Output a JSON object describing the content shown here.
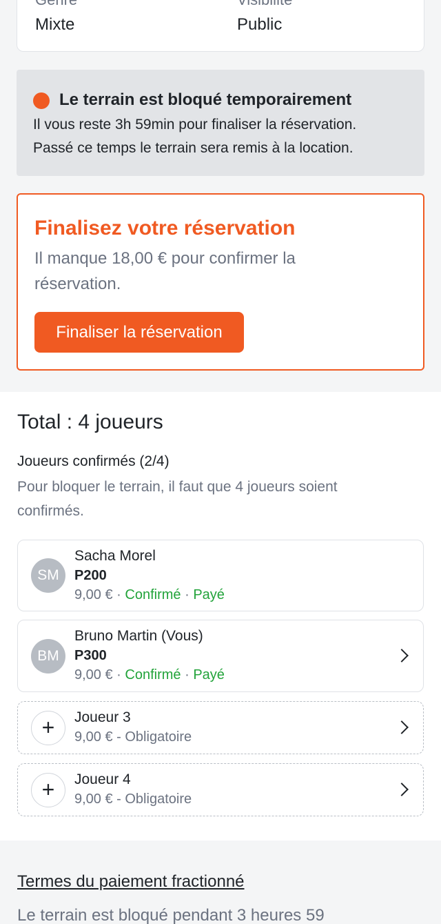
{
  "info": {
    "label1": "Genre",
    "value1": "Mixte",
    "label2": "Visibilité",
    "value2": "Public"
  },
  "notice": {
    "title": "Le terrain est bloqué temporairement",
    "line1": "Il vous reste 3h 59min pour finaliser la réservation.",
    "line2": "Passé ce temps le terrain sera remis à la location."
  },
  "finalize": {
    "title": "Finalisez votre réservation",
    "description": "Il manque 18,00 € pour confirmer la réservation.",
    "button": "Finaliser la réservation"
  },
  "players": {
    "total": "Total : 4 joueurs",
    "confirmed_title": "Joueurs confirmés (2/4)",
    "confirmed_desc": "Pour bloquer le terrain, il faut que 4 joueurs soient confirmés.",
    "list": [
      {
        "initials": "SM",
        "name": "Sacha Morel",
        "level": "P200",
        "price": "9,00 €",
        "sep": " · ",
        "status": "Confirmé",
        "payment": "Payé"
      },
      {
        "initials": "BM",
        "name": "Bruno Martin (Vous)",
        "level": "P300",
        "price": "9,00 €",
        "sep": " · ",
        "status": "Confirmé",
        "payment": "Payé"
      }
    ],
    "slots": [
      {
        "name": "Joueur 3",
        "meta": "9,00 € - Obligatoire"
      },
      {
        "name": "Joueur 4",
        "meta": "9,00 € - Obligatoire"
      }
    ]
  },
  "terms": {
    "link": "Termes du paiement fractionné",
    "text": "Le terrain est bloqué pendant 3 heures 59"
  },
  "colors": {
    "accent": "#f05a22",
    "success": "#22a33a",
    "muted": "#6b7280"
  }
}
